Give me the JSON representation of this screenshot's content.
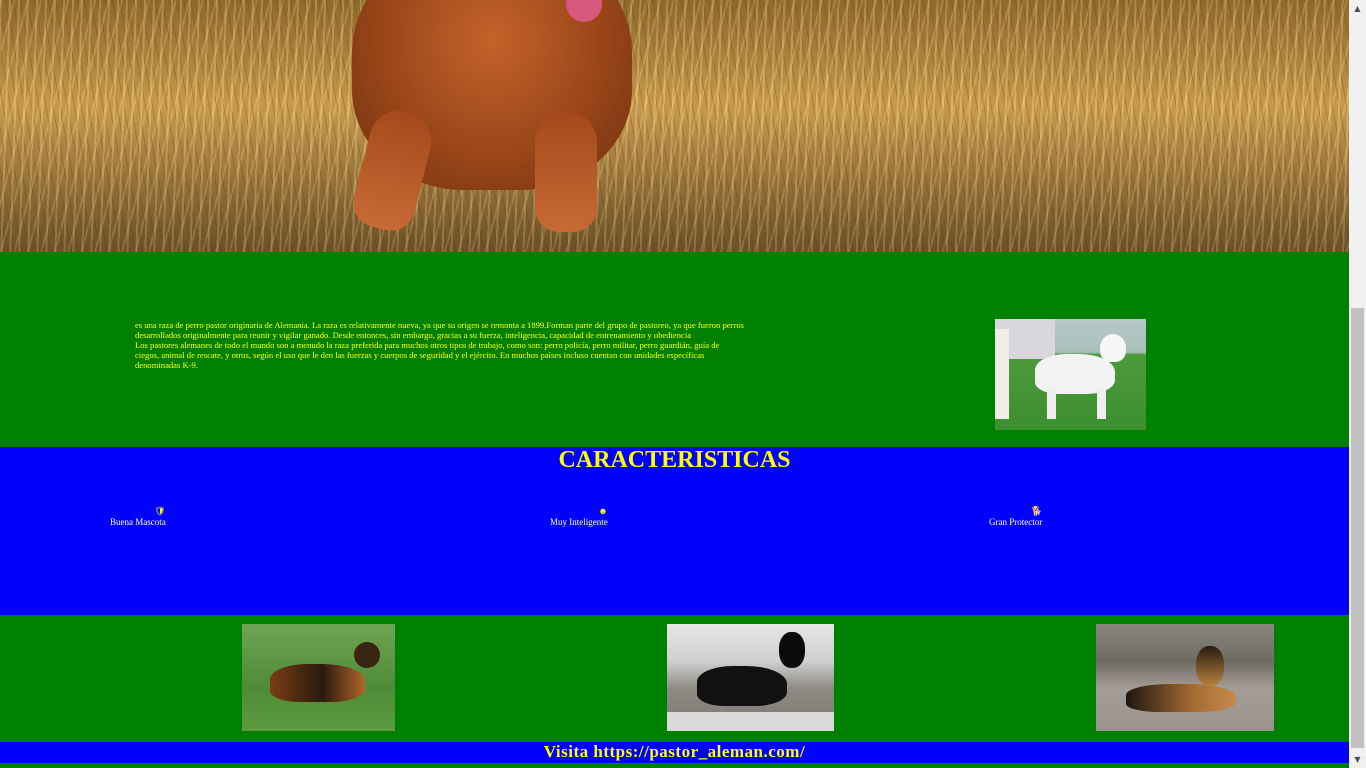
{
  "intro": {
    "paragraph1": "es una raza de perro pastor originaria de Alemania. La raza es relativamente nueva, ya que su origen se remonta a 1899.Forman parte del grupo de pastoreo, ya que fueron perros desarrollados originalmente para reunir y vigilar ganado. Desde entonces, sin embargo, gracias a su fuerza, inteligencia, capacidad de entrenamiento y obediencia",
    "paragraph2": "Los pastores alemanes de todo el mundo son a menudo la raza preferida para muchos otros tipos de trabajo, como son: perro policía, perro militar, perro guardián, guía de ciegos, animal de rescate, y otros, según el uso que le den las fuerzas y cuerpos de seguridad y el ejército. En muchos países incluso cuentan con unidades específicas denominadas K-9."
  },
  "caracteristicas": {
    "title": "CARACTERISTICAS",
    "features": [
      {
        "icon": "shield-icon",
        "glyph": "🛡",
        "label": "Buena Mascota"
      },
      {
        "icon": "brain-icon",
        "glyph": "☻",
        "label": "Muy Inteligente"
      },
      {
        "icon": "dog-icon",
        "glyph": "🐕",
        "label": "Gran Protector"
      }
    ]
  },
  "footer": {
    "link_text": "Visita https://pastor_aleman.com/"
  },
  "colors": {
    "green_section": "#008000",
    "blue_section": "#0000ff",
    "accent_text": "#ffff00",
    "feature_text": "#ffffff"
  },
  "scrollbar": {
    "up_glyph": "▲",
    "down_glyph": "▼"
  }
}
